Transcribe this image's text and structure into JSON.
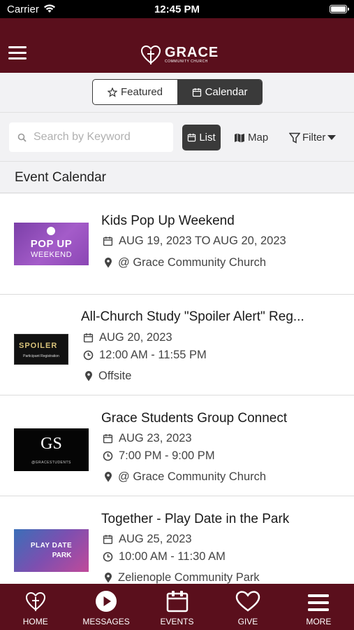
{
  "status_bar": {
    "carrier": "Carrier",
    "time": "12:45 PM"
  },
  "header": {
    "brand_name": "GRACE",
    "brand_sub": "COMMUNITY CHURCH"
  },
  "segment": {
    "featured_label": "Featured",
    "calendar_label": "Calendar",
    "active": "calendar"
  },
  "search": {
    "placeholder": "Search by Keyword",
    "value": ""
  },
  "view": {
    "list_label": "List",
    "map_label": "Map",
    "filter_label": "Filter"
  },
  "section_title": "Event Calendar",
  "events": [
    {
      "title": "Kids Pop Up Weekend",
      "date": "AUG 19, 2023 TO AUG 20, 2023",
      "location": "@ Grace Community Church",
      "thumb_top": "POP UP",
      "thumb_bottom": "WEEKEND"
    },
    {
      "title": "All-Church Study \"Spoiler Alert\" Reg...",
      "date": "AUG 20, 2023",
      "time": "12:00 AM - 11:55 PM",
      "location": "Offsite",
      "thumb_top": "SPOILER",
      "thumb_bottom": "Participant Registration"
    },
    {
      "title": "Grace Students Group Connect",
      "date": "AUG 23, 2023",
      "time": "7:00 PM - 9:00 PM",
      "location": "@ Grace Community Church",
      "thumb_top": "GS",
      "thumb_bottom": "@GRACESTUDENTS"
    },
    {
      "title": "Together - Play Date in the Park",
      "date": "AUG 25, 2023",
      "time": "10:00 AM - 11:30 AM",
      "location": "Zelienople Community Park",
      "thumb_top": "PLAY DATE",
      "thumb_bottom": "PARK"
    }
  ],
  "tabs": [
    {
      "label": "HOME",
      "icon": "heart-cross-icon"
    },
    {
      "label": "MESSAGES",
      "icon": "play-icon"
    },
    {
      "label": "EVENTS",
      "icon": "calendar-icon"
    },
    {
      "label": "GIVE",
      "icon": "heart-icon"
    },
    {
      "label": "MORE",
      "icon": "menu-icon"
    }
  ],
  "colors": {
    "brand": "#5a0f1c",
    "dark_button": "#3a3a3a",
    "background": "#f2f2f4"
  }
}
